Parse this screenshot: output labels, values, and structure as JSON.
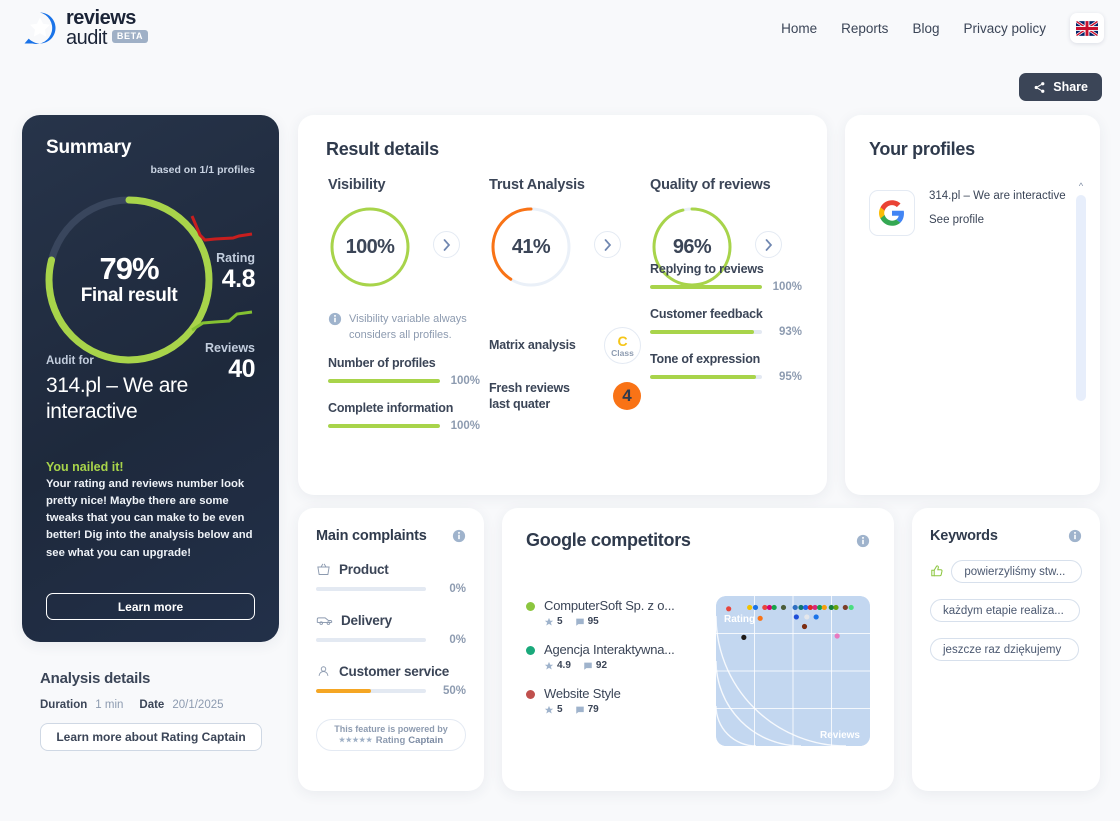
{
  "header": {
    "logo_line1": "reviews",
    "logo_line2": "audit",
    "beta": "BETA",
    "nav": [
      {
        "label": "Home"
      },
      {
        "label": "Reports"
      },
      {
        "label": "Blog"
      },
      {
        "label": "Privacy policy"
      }
    ],
    "language_flag": "uk-flag",
    "share_label": "Share"
  },
  "summary": {
    "title": "Summary",
    "based_on": "based on 1/1 profiles",
    "final_pct": "79%",
    "final_label": "Final result",
    "final_value": 79,
    "rating_label": "Rating",
    "rating_value": "4.8",
    "reviews_label": "Reviews",
    "reviews_value": "40",
    "audit_for_label": "Audit for",
    "audit_name": "314.pl – We are interactive",
    "verdict_title": "You nailed it!",
    "verdict_body": "Your rating and reviews number look pretty nice! Maybe there are some tweaks that you can make to be even better! Dig into the analysis below and see what you can upgrade!",
    "learn_more": "Learn more",
    "accent_green": "#a8d44a",
    "rating_spark_color": "#c81e1e",
    "reviews_spark_color": "#84c132"
  },
  "analysis_details": {
    "title": "Analysis details",
    "duration_label": "Duration",
    "duration_value": "1 min",
    "date_label": "Date",
    "date_value": "20/1/2025",
    "button_label": "Learn more about Rating Captain"
  },
  "results": {
    "title": "Result details",
    "metrics": [
      {
        "name": "Visibility",
        "value": "100%",
        "pct": 100,
        "color": "#a8d44a"
      },
      {
        "name": "Trust Analysis",
        "value": "41%",
        "pct": 41,
        "color": "#f97316"
      },
      {
        "name": "Quality of reviews",
        "value": "96%",
        "pct": 96,
        "color": "#a8d44a"
      }
    ],
    "visibility_note": "Visibility variable always considers all profiles.",
    "visibility_bars": [
      {
        "label": "Number of profiles",
        "value": "100%",
        "pct": 100,
        "color": "#a8d44a"
      },
      {
        "label": "Complete information",
        "value": "100%",
        "pct": 100,
        "color": "#a8d44a"
      }
    ],
    "trust_items": [
      {
        "label": "Matrix analysis",
        "badge_type": "class",
        "letter": "C",
        "word": "Class"
      },
      {
        "label": "Fresh reviews last quater",
        "badge_type": "count",
        "count": "4"
      }
    ],
    "quality_bars": [
      {
        "label": "Replying to reviews",
        "value": "100%",
        "pct": 100,
        "color": "#a8d44a"
      },
      {
        "label": "Customer feedback",
        "value": "93%",
        "pct": 93,
        "color": "#a8d44a"
      },
      {
        "label": "Tone of expression",
        "value": "95%",
        "pct": 95,
        "color": "#a8d44a"
      }
    ]
  },
  "profiles": {
    "title": "Your profiles",
    "items": [
      {
        "icon": "google-icon",
        "name": "314.pl – We are interactive",
        "link": "See profile"
      }
    ]
  },
  "complaints": {
    "title": "Main complaints",
    "items": [
      {
        "icon": "basket-icon",
        "label": "Product",
        "value": "0%",
        "pct": 0,
        "color": "#f5a623"
      },
      {
        "icon": "truck-icon",
        "label": "Delivery",
        "value": "0%",
        "pct": 0,
        "color": "#f5a623"
      },
      {
        "icon": "person-icon",
        "label": "Customer service",
        "value": "50%",
        "pct": 50,
        "color": "#f5a623"
      }
    ],
    "powered_line1": "This feature is powered by",
    "powered_stars": "★★★★★",
    "powered_brand_1": "Rating",
    "powered_brand_2": "Captain"
  },
  "competitors": {
    "title": "Google competitors",
    "items": [
      {
        "color": "#8cc63f",
        "name": "ComputerSoft Sp. z o...",
        "rating": "5",
        "reviews": "95"
      },
      {
        "color": "#1aa97b",
        "name": "Agencja Interaktywna...",
        "rating": "4.9",
        "reviews": "92"
      },
      {
        "color": "#c0504d",
        "name": "Website Style",
        "rating": "5",
        "reviews": "79"
      }
    ],
    "chart_data": {
      "type": "scatter",
      "title": "Google competitors",
      "xlabel": "Reviews",
      "ylabel": "Rating",
      "grid": true,
      "points": [
        {
          "x": 4,
          "y": 95,
          "color": "#e8453c"
        },
        {
          "x": 22,
          "y": 96,
          "color": "#f2c200"
        },
        {
          "x": 27,
          "y": 96,
          "color": "#1a73e8"
        },
        {
          "x": 35,
          "y": 96,
          "color": "#e8453c"
        },
        {
          "x": 39,
          "y": 96,
          "color": "#d9006c"
        },
        {
          "x": 43,
          "y": 96,
          "color": "#16a34a"
        },
        {
          "x": 51,
          "y": 96,
          "color": "#4b5d3a"
        },
        {
          "x": 61,
          "y": 96,
          "color": "#2f6fc2"
        },
        {
          "x": 66,
          "y": 96,
          "color": "#0f766e"
        },
        {
          "x": 70,
          "y": 96,
          "color": "#2563eb"
        },
        {
          "x": 74,
          "y": 96,
          "color": "#dc2626"
        },
        {
          "x": 78,
          "y": 96,
          "color": "#db2777"
        },
        {
          "x": 82,
          "y": 96,
          "color": "#16a34a"
        },
        {
          "x": 86,
          "y": 96,
          "color": "#f59e0b"
        },
        {
          "x": 92,
          "y": 96,
          "color": "#15803d"
        },
        {
          "x": 96,
          "y": 96,
          "color": "#65a30d"
        },
        {
          "x": 104,
          "y": 96,
          "color": "#7c3f2a"
        },
        {
          "x": 109,
          "y": 96,
          "color": "#4ade80"
        },
        {
          "x": 31,
          "y": 88,
          "color": "#f97316"
        },
        {
          "x": 62,
          "y": 89,
          "color": "#1d4ed8"
        },
        {
          "x": 71,
          "y": 89,
          "color": "#e5e7eb"
        },
        {
          "x": 79,
          "y": 89,
          "color": "#1a73e8"
        },
        {
          "x": 69,
          "y": 82,
          "color": "#7c2d12"
        },
        {
          "x": 97,
          "y": 75,
          "color": "#e879c0"
        },
        {
          "x": 17,
          "y": 74,
          "color": "#1c1917"
        }
      ],
      "xlim": [
        0,
        120
      ],
      "ylim": [
        0,
        100
      ]
    }
  },
  "keywords": {
    "title": "Keywords",
    "items": [
      {
        "text": "powierzyliśmy stw...",
        "sentiment": "positive"
      },
      {
        "text": "każdym etapie realiza...",
        "sentiment": "neutral"
      },
      {
        "text": "jeszcze raz dziękujemy",
        "sentiment": "neutral"
      }
    ]
  }
}
